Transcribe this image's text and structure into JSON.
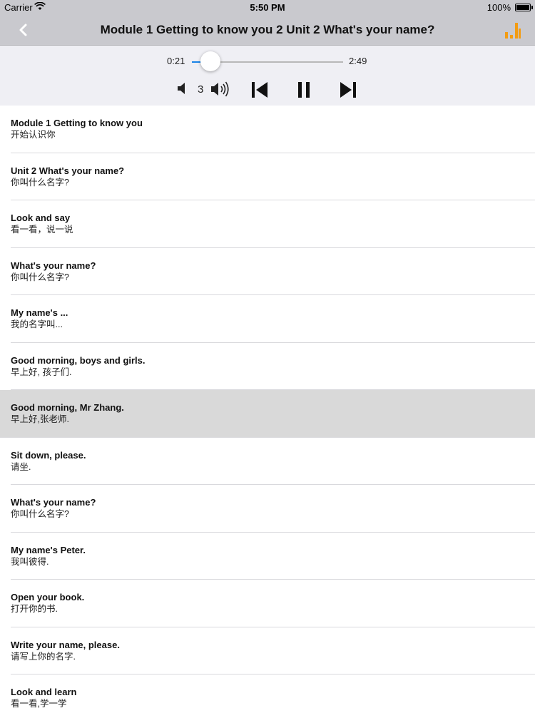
{
  "status_bar": {
    "carrier": "Carrier",
    "time": "5:50 PM",
    "battery": "100%",
    "wifi_icon": "wifi-icon",
    "battery_icon": "battery-icon"
  },
  "nav": {
    "title": "Module 1 Getting to know you 2 Unit 2 What's your name?",
    "back_icon": "chevron-left-icon",
    "menu_icon": "bar-chart-icon",
    "accent_color": "#f39c12"
  },
  "player": {
    "current_time": "0:21",
    "total_time": "2:49",
    "progress": 0.124,
    "volume": "3",
    "accent_color": "#1a84e8",
    "icons": [
      "volume-low-icon",
      "volume-high-icon",
      "skip-previous-icon",
      "pause-icon",
      "skip-next-icon"
    ]
  },
  "list": {
    "selected_index": 6,
    "items": [
      {
        "en": "Module 1 Getting to know you",
        "zh": "开始认识你"
      },
      {
        "en": "Unit 2 What's your name?",
        "zh": "你叫什么名字?"
      },
      {
        "en": "Look and say",
        "zh": "看一看，说一说"
      },
      {
        "en": "What's your name?",
        "zh": "你叫什么名字?"
      },
      {
        "en": "My name's ...",
        "zh": "我的名字叫..."
      },
      {
        "en": "Good morning, boys and girls.",
        "zh": "早上好, 孩子们."
      },
      {
        "en": "Good morning, Mr Zhang.",
        "zh": "早上好,张老师."
      },
      {
        "en": "Sit down, please.",
        "zh": "请坐."
      },
      {
        "en": "What's your name?",
        "zh": "你叫什么名字?"
      },
      {
        "en": "My name's Peter.",
        "zh": "我叫彼得."
      },
      {
        "en": "Open your book.",
        "zh": "打开你的书."
      },
      {
        "en": "Write your name, please.",
        "zh": "请写上你的名字."
      },
      {
        "en": "Look and learn",
        "zh": "看一看,学一学"
      }
    ]
  }
}
